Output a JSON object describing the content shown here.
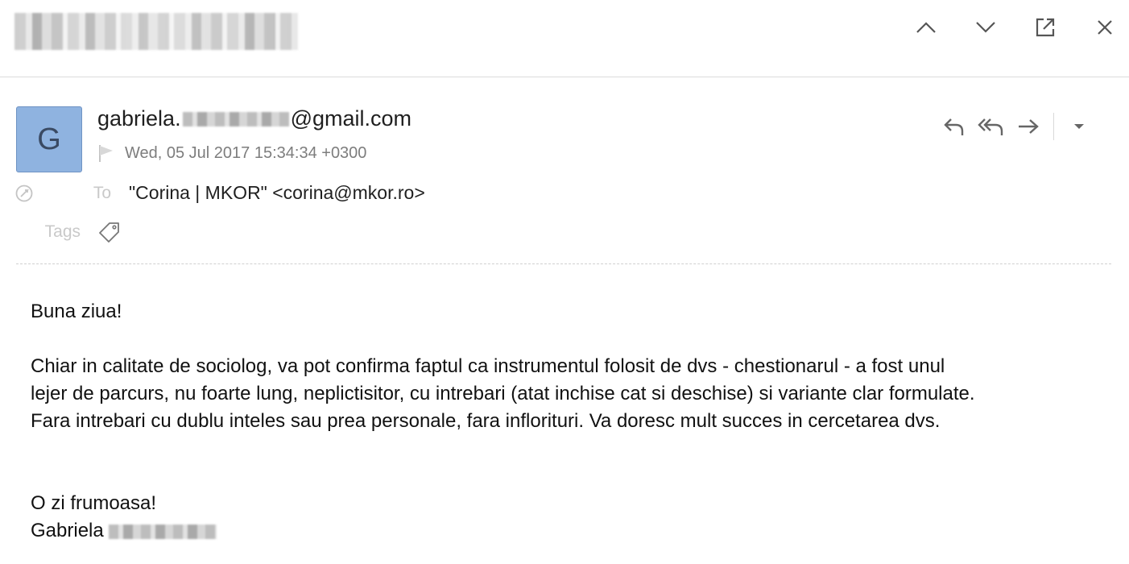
{
  "header": {
    "icons": [
      "chevron-up-icon",
      "chevron-down-icon",
      "open-external-icon",
      "close-icon"
    ]
  },
  "message": {
    "avatar_initial": "G",
    "sender_prefix": "gabriela.",
    "sender_suffix": "@gmail.com",
    "date": "Wed, 05 Jul 2017 15:34:34 +0300",
    "to_label": "To",
    "to_value": "\"Corina | MKOR\" <corina@mkor.ro>",
    "tags_label": "Tags",
    "actions": [
      "reply-icon",
      "reply-all-icon",
      "forward-icon",
      "more-dropdown-icon"
    ]
  },
  "body": {
    "greeting": "Buna ziua!",
    "paragraph_lines": [
      "Chiar in calitate de sociolog, va pot confirma faptul ca instrumentul folosit de dvs - chestionarul - a fost unul",
      "lejer de parcurs, nu foarte lung, neplictisitor, cu intrebari (atat inchise cat si deschise) si variante clar formulate.",
      "Fara intrebari cu dublu inteles sau prea personale, fara inflorituri. Va doresc mult succes in cercetarea dvs."
    ],
    "closing": "O zi frumoasa!",
    "signature_name": "Gabriela"
  },
  "colors": {
    "avatar_bg": "#8fb3e0",
    "muted_text": "#7d7d7d",
    "label_text": "#c9c9c9",
    "icon": "#666666"
  }
}
